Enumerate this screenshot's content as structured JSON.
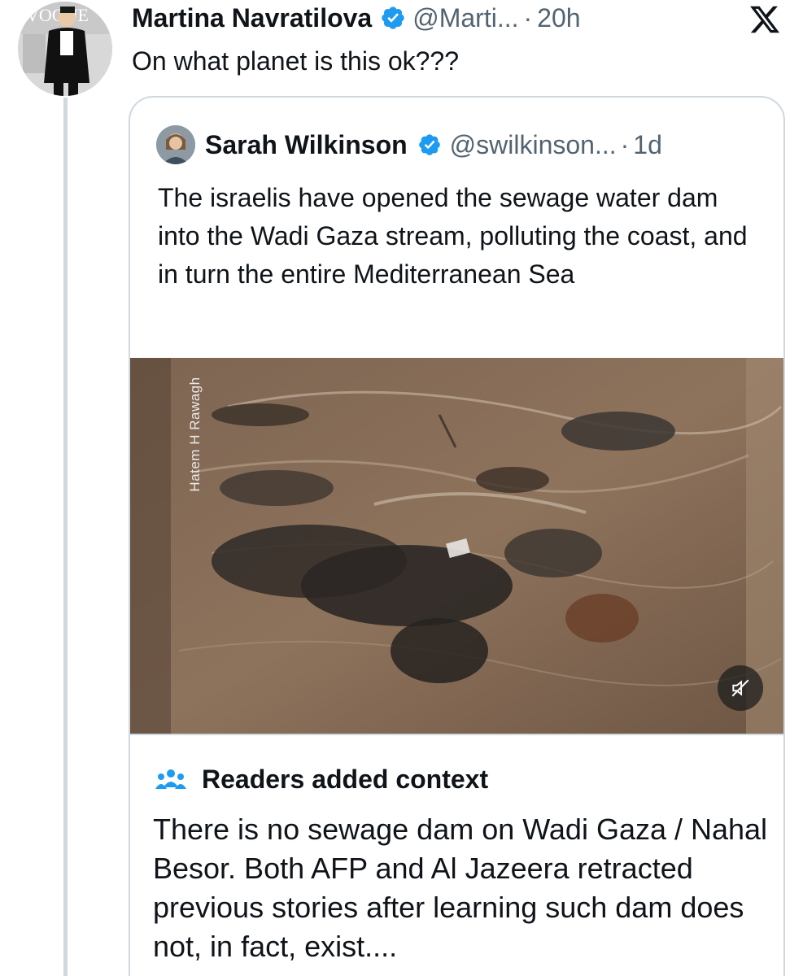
{
  "tweet": {
    "author_name": "Martina Navratilova",
    "handle": "@Marti...",
    "separator": "·",
    "time": "20h",
    "text": "On what planet is this ok???",
    "avatar_text": "VOGUE"
  },
  "quote": {
    "author_name": "Sarah Wilkinson",
    "handle": "@swilkinson...",
    "separator": "·",
    "time": "1d",
    "text": "The israelis have opened the sewage water dam into the Wadi Gaza stream, polluting the coast, and in turn the entire Mediterranean Sea",
    "media": {
      "watermark": "Hatem H Rawagh",
      "mute_icon": "muted-speaker-icon"
    }
  },
  "context": {
    "title": "Readers added context",
    "icon": "people-icon",
    "body": "There is no sewage dam on Wadi Gaza / Nahal Besor. Both AFP and Al Jazeera retracted previous stories after learning such dam does not, in fact, exist...."
  },
  "colors": {
    "text": "#0f1419",
    "secondary": "#536471",
    "verified": "#1d9bf0",
    "border": "#cfd9de"
  }
}
